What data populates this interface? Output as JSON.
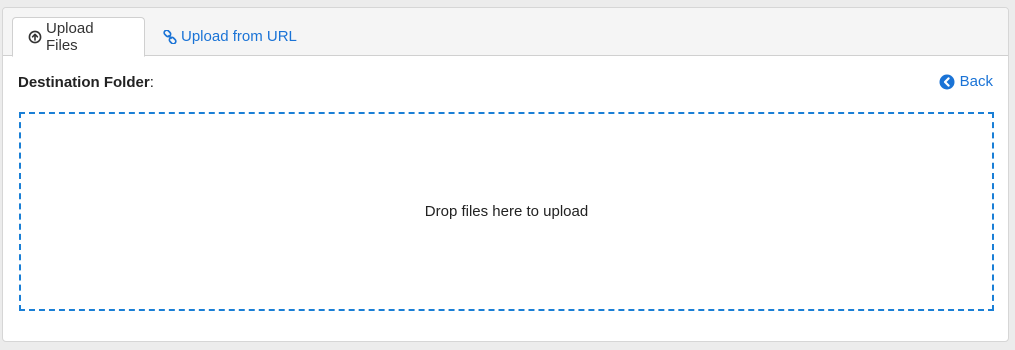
{
  "tabs": [
    {
      "label": "Upload Files",
      "icon": "arrow-up-circle-icon",
      "active": true
    },
    {
      "label": "Upload from URL",
      "icon": "link-icon",
      "active": false
    }
  ],
  "destination": {
    "label": "Destination Folder",
    "suffix": ":"
  },
  "back": {
    "label": "Back",
    "icon": "chevron-left-circle-icon"
  },
  "dropzone": {
    "text": "Drop files here to upload"
  },
  "colors": {
    "accent": "#1a73d6",
    "dropzone_border": "#1a7fd6",
    "tabbar_bg": "#f5f5f5",
    "page_bg": "#ececec"
  }
}
